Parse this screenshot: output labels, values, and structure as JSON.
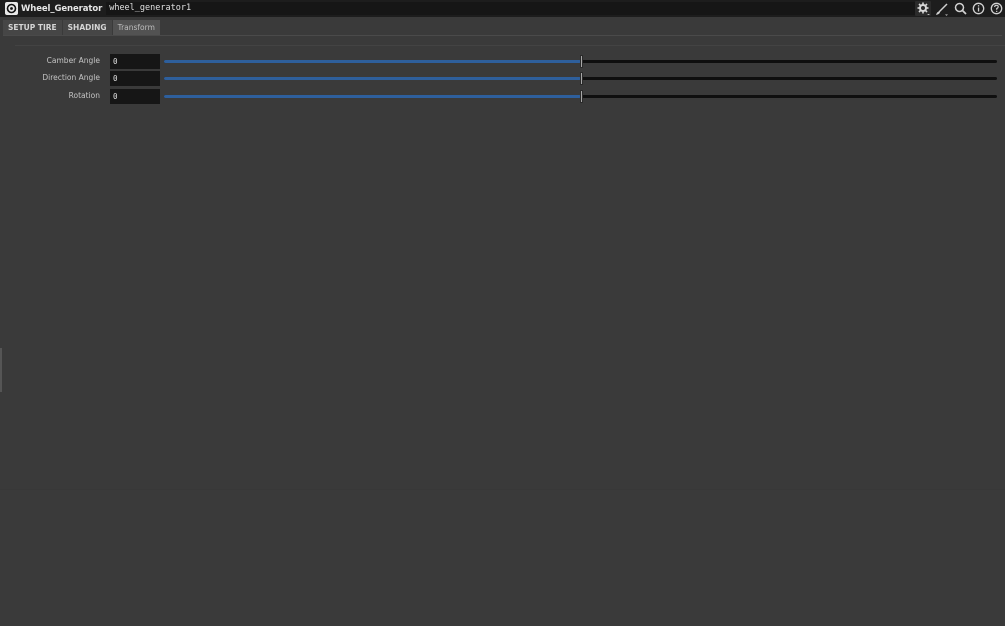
{
  "header": {
    "node_type": "Wheel_Generator",
    "node_name": "wheel_generator1",
    "tools": [
      "gear-icon",
      "brush-icon",
      "search-icon",
      "info-icon",
      "help-icon"
    ]
  },
  "tabs": [
    {
      "label": "SETUP TIRE",
      "active": false
    },
    {
      "label": "SHADING",
      "active": false
    },
    {
      "label": "Transform",
      "active": true
    }
  ],
  "params": [
    {
      "label": "Camber Angle",
      "value": "0",
      "slider_fraction": 0.5
    },
    {
      "label": "Direction Angle",
      "value": "0",
      "slider_fraction": 0.5
    },
    {
      "label": "Rotation",
      "value": "0",
      "slider_fraction": 0.5
    }
  ],
  "colors": {
    "background": "#3a3a3a",
    "header": "#1d1d1d",
    "field": "#161616",
    "slider_fill": "#2e5f9c",
    "slider_track": "#0f0f0f"
  }
}
